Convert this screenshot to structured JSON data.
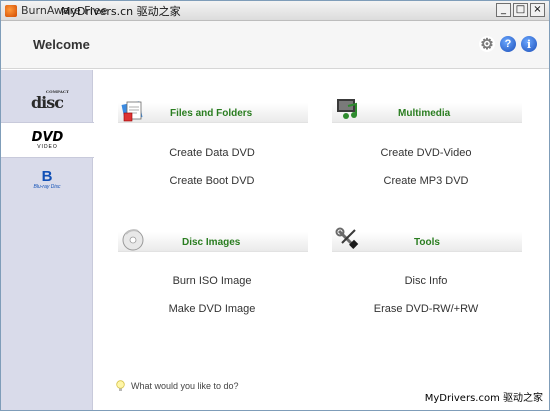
{
  "window": {
    "title": "BurnAware Free",
    "title_overlay": "MyDrivers.cn 驱动之家",
    "controls": {
      "minimize": "_",
      "maximize": "□",
      "close": "×"
    }
  },
  "header": {
    "title": "Welcome",
    "icons": [
      "gear-icon",
      "help-icon",
      "info-icon"
    ],
    "help_glyph": "?",
    "info_glyph": "i"
  },
  "sidebar": {
    "items": [
      {
        "name": "compact-disc",
        "label": "disc",
        "sub": "COMPACT"
      },
      {
        "name": "dvd",
        "label": "DVD",
        "sub": "VIDEO"
      },
      {
        "name": "blu-ray",
        "label": "B",
        "sub": "Blu-ray Disc"
      }
    ],
    "active_index": 1
  },
  "sections": [
    {
      "title": "Files and Folders",
      "icon": "files-folders-icon",
      "links": [
        "Create Data DVD",
        "Create Boot DVD"
      ]
    },
    {
      "title": "Multimedia",
      "icon": "multimedia-icon",
      "links": [
        "Create DVD-Video",
        "Create MP3 DVD"
      ]
    },
    {
      "title": "Disc Images",
      "icon": "disc-images-icon",
      "links": [
        "Burn ISO Image",
        "Make DVD Image"
      ]
    },
    {
      "title": "Tools",
      "icon": "tools-icon",
      "links": [
        "Disc Info",
        "Erase DVD-RW/+RW"
      ]
    }
  ],
  "tip": {
    "text": "What would you like to do?",
    "icon": "lightbulb-icon"
  },
  "watermark": "MyDrivers.com 驱动之家",
  "colors": {
    "section_title": "#2a7d20",
    "sidebar_bg": "#d9dbea",
    "link_text": "#333333"
  }
}
